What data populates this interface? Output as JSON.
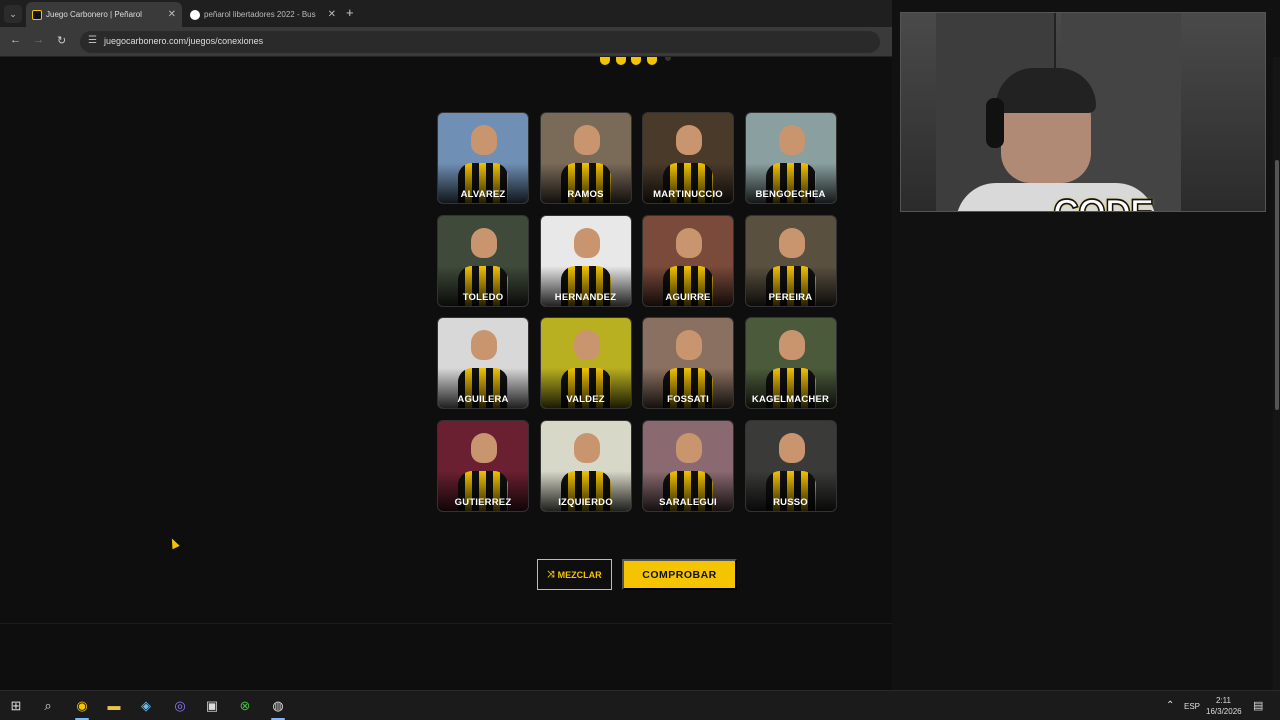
{
  "browser": {
    "tabs": [
      {
        "title": "Juego Carbonero | Peñarol",
        "active": true
      },
      {
        "title": "peñarol libertadores 2022 - Bus",
        "active": false
      }
    ],
    "new_tab": "+",
    "url": "juegocarbonero.com/juegos/conexiones"
  },
  "game": {
    "progress_dots_filled": 4,
    "progress_dots_total": 5,
    "players": [
      {
        "name": "ALVAREZ",
        "bg": "#6f8fb5"
      },
      {
        "name": "RAMOS",
        "bg": "#7a6a58"
      },
      {
        "name": "MARTINUCCIO",
        "bg": "#4a3a2a"
      },
      {
        "name": "BENGOECHEA",
        "bg": "#8aa0a0"
      },
      {
        "name": "TOLEDO",
        "bg": "#3f4a3a"
      },
      {
        "name": "HERNANDEZ",
        "bg": "#e8e8e8"
      },
      {
        "name": "AGUIRRE",
        "bg": "#7a4a3a"
      },
      {
        "name": "PEREIRA",
        "bg": "#5a5040"
      },
      {
        "name": "AGUILERA",
        "bg": "#d8d8d8"
      },
      {
        "name": "VALDEZ",
        "bg": "#b8b020"
      },
      {
        "name": "FOSSATI",
        "bg": "#8a7060"
      },
      {
        "name": "KAGELMACHER",
        "bg": "#4a5a3a"
      },
      {
        "name": "GUTIERREZ",
        "bg": "#6a2030"
      },
      {
        "name": "IZQUIERDO",
        "bg": "#d8d8c8"
      },
      {
        "name": "SARALEGUI",
        "bg": "#8a6a70"
      },
      {
        "name": "RUSSO",
        "bg": "#3a3a38"
      }
    ],
    "shuffle_label": "MEZCLAR",
    "shuffle_icon": "shuffle-icon",
    "check_label": "COMPROBAR"
  },
  "webcam": {
    "overlay_text": "CODE"
  },
  "taskbar": {
    "lang": "ESP",
    "time": "2:11",
    "date": "16/3/2026"
  },
  "colors": {
    "accent": "#f5c400",
    "background": "#0e0e0e"
  }
}
